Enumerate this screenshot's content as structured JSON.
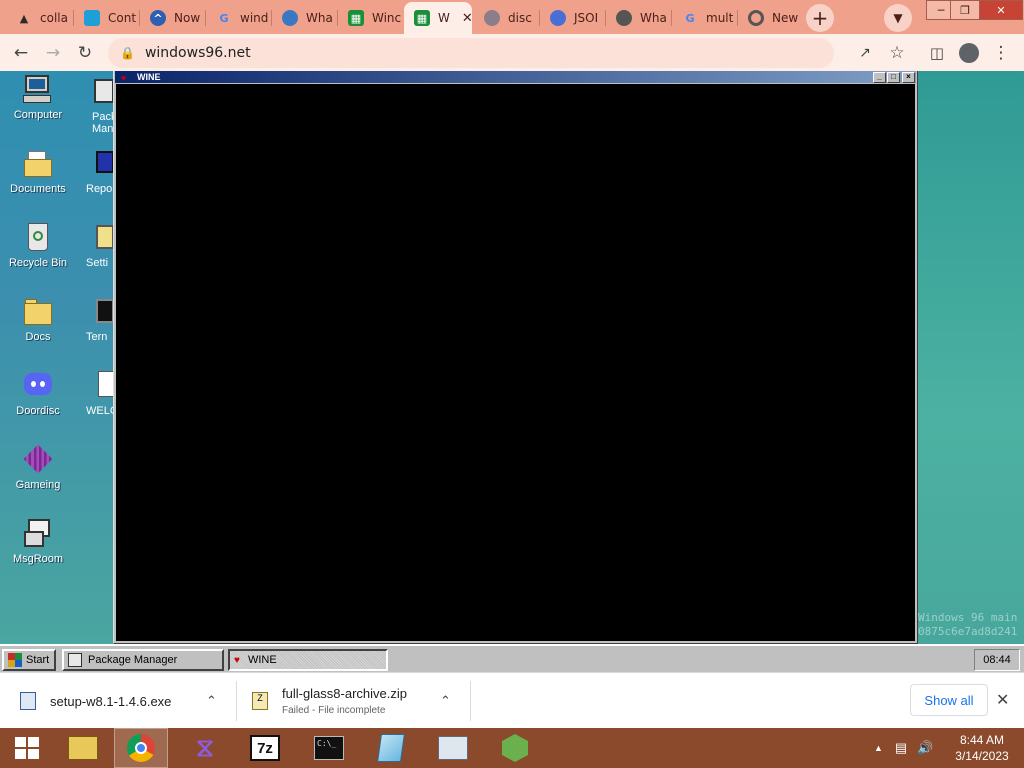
{
  "browser": {
    "tabs": [
      {
        "label": "colla",
        "icon": "upload-icon",
        "color": "#2b2b2b"
      },
      {
        "label": "Cont",
        "icon": "page-icon",
        "color": "#1ea0d6"
      },
      {
        "label": "Now",
        "icon": "chevron-badge-icon",
        "color": "#2f5fb2"
      },
      {
        "label": "wind",
        "icon": "google-icon",
        "color": "#4285f4"
      },
      {
        "label": "Wha",
        "icon": "globe-icon",
        "color": "#3b78c4"
      },
      {
        "label": "Winc",
        "icon": "windows96-icon",
        "color": "#1a8f3a"
      },
      {
        "label": "W",
        "icon": "windows96-icon",
        "color": "#1a8f3a"
      },
      {
        "label": "disc",
        "icon": "discord-icon",
        "color": "#8b7d89"
      },
      {
        "label": "JSOI",
        "icon": "json-icon",
        "color": "#4b6ed4"
      },
      {
        "label": "Wha",
        "icon": "globe-icon",
        "color": "#555555"
      },
      {
        "label": "mult",
        "icon": "google-icon",
        "color": "#4285f4"
      },
      {
        "label": "New",
        "icon": "chrome-icon",
        "color": "#555555"
      }
    ],
    "active_tab": 6,
    "url": "windows96.net"
  },
  "desktop": {
    "icons": [
      {
        "label": "Computer",
        "icon": "computer-icon"
      },
      {
        "label": "Documents",
        "icon": "documents-folder-icon"
      },
      {
        "label": "Recycle Bin",
        "icon": "recycle-bin-icon"
      },
      {
        "label": "Docs",
        "icon": "folder-icon"
      },
      {
        "label": "Doordisc",
        "icon": "discord-icon"
      },
      {
        "label": "Gameing",
        "icon": "cube-icon"
      },
      {
        "label": "MsgRoom",
        "icon": "msgroom-icon"
      }
    ],
    "icons_col2": [
      {
        "label": "Pack Man",
        "icon": "package-manager-icon"
      },
      {
        "label": "Repo",
        "icon": "repository-icon"
      },
      {
        "label": "Setti",
        "icon": "settings-icon"
      },
      {
        "label": "Tern",
        "icon": "terminal-icon"
      },
      {
        "label": "WELC",
        "icon": "welcome-icon"
      }
    ],
    "watermark": [
      "Windows 96 main",
      "0875c6e7ad8d241"
    ]
  },
  "wine_window": {
    "title": "WINE",
    "minimize": "_",
    "maximize": "□",
    "close": "×"
  },
  "win96_taskbar": {
    "start_label": "Start",
    "buttons": [
      {
        "label": "Package Manager"
      },
      {
        "label": "WINE"
      }
    ],
    "clock": "08:44"
  },
  "downloads": {
    "items": [
      {
        "name": "setup-w8.1-1.4.6.exe",
        "status": ""
      },
      {
        "name": "full-glass8-archive.zip",
        "status": "Failed - File incomplete"
      }
    ],
    "show_all": "Show all"
  },
  "windows_taskbar": {
    "pinned": [
      {
        "icon": "file-explorer-icon"
      },
      {
        "icon": "chrome-icon"
      },
      {
        "icon": "visual-studio-icon"
      },
      {
        "icon": "7zip-icon"
      },
      {
        "icon": "command-prompt-icon"
      },
      {
        "icon": "notepad-icon"
      },
      {
        "icon": "control-panel-icon"
      },
      {
        "icon": "android-studio-icon"
      }
    ],
    "time": "8:44 AM",
    "date": "3/14/2023"
  }
}
